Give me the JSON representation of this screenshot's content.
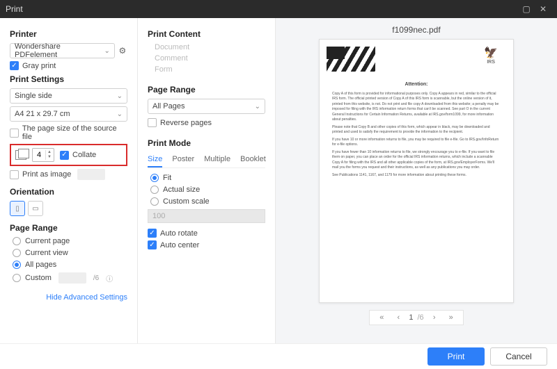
{
  "window": {
    "title": "Print"
  },
  "printer": {
    "heading": "Printer",
    "selected": "Wondershare PDFelement",
    "gray_print": "Gray print"
  },
  "print_settings": {
    "heading": "Print Settings",
    "duplex": "Single side",
    "paper": "A4 21 x 29.7 cm",
    "source_size": "The page size of the source file",
    "copies": "4",
    "collate": "Collate",
    "print_as_image": "Print as image"
  },
  "orientation": {
    "heading": "Orientation"
  },
  "left_page_range": {
    "heading": "Page Range",
    "current_page": "Current page",
    "current_view": "Current view",
    "all_pages": "All pages",
    "custom": "Custom",
    "total_suffix": "/6"
  },
  "advanced_link": "Hide Advanced Settings",
  "print_content": {
    "heading": "Print Content",
    "document": "Document",
    "comment": "Comment",
    "form": "Form"
  },
  "mid_page_range": {
    "heading": "Page Range",
    "all_pages": "All Pages",
    "reverse": "Reverse pages"
  },
  "print_mode": {
    "heading": "Print Mode",
    "tabs": {
      "size": "Size",
      "poster": "Poster",
      "multiple": "Multiple",
      "booklet": "Booklet"
    },
    "fit": "Fit",
    "actual": "Actual size",
    "custom_scale": "Custom scale",
    "scale_value": "100",
    "auto_rotate": "Auto rotate",
    "auto_center": "Auto center"
  },
  "preview": {
    "filename": "f1099nec.pdf",
    "attention": "Attention:",
    "irs_label": "IRS",
    "pager_current": "1",
    "pager_total": "/6"
  },
  "footer": {
    "print": "Print",
    "cancel": "Cancel"
  }
}
